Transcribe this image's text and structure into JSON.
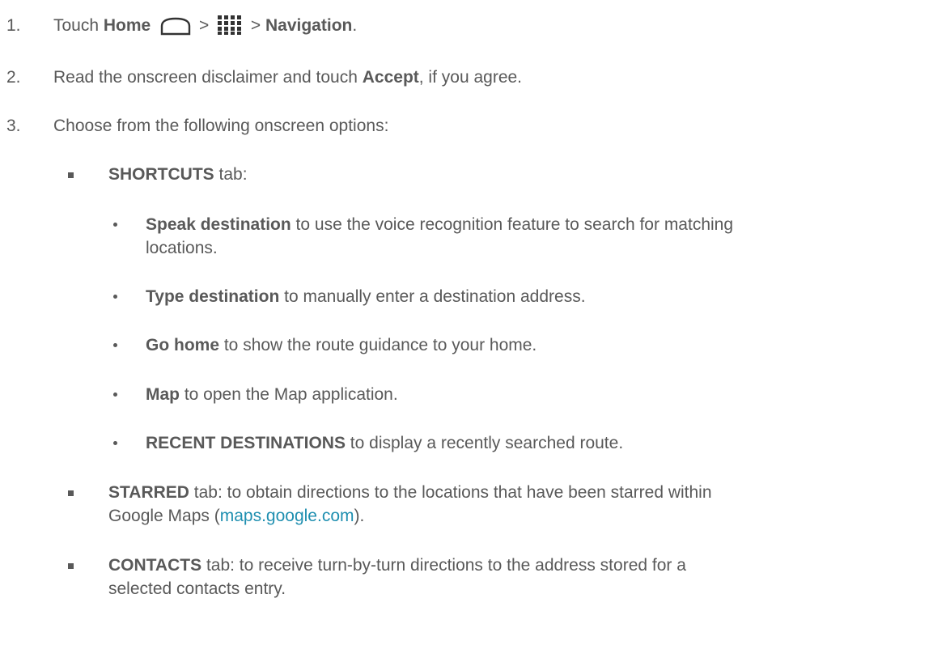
{
  "steps": [
    {
      "num": "1.",
      "pre": "Touch",
      "home_bold": "Home",
      "sep1": ">",
      "sep2": ">",
      "nav_bold": "Navigation",
      "end": "."
    },
    {
      "num": "2.",
      "pre": "Read the onscreen disclaimer and touch",
      "bold": "Accept",
      "post": ", if you agree."
    },
    {
      "num": "3.",
      "text": "Choose from the following onscreen options:"
    }
  ],
  "shortcuts": {
    "bold": "SHORTCUTS",
    "post": " tab:",
    "items": [
      {
        "bold": "Speak destination",
        "line1": " to use the voice recognition feature to search for matching",
        "line2": "locations."
      },
      {
        "bold": "Type destination",
        "post": " to manually enter a destination address."
      },
      {
        "bold": "Go home",
        "post": " to show the route guidance to your home."
      },
      {
        "bold": "Map",
        "post": " to open the Map application."
      },
      {
        "bold": "RECENT DESTINATIONS",
        "post": " to display a recently searched route."
      }
    ]
  },
  "starred": {
    "bold": "STARRED",
    "line1": " tab: to obtain directions to the locations that have been starred within",
    "line2_pre": "Google Maps (",
    "link": "maps.google.com",
    "line2_post": ")."
  },
  "contacts": {
    "bold": "CONTACTS",
    "line1": " tab: to receive turn-by-turn directions to the address stored for a",
    "line2": "selected contacts entry."
  },
  "colors": {
    "text": "#595959",
    "link": "#1f8fb0"
  },
  "icons": {
    "home": "home-outline-icon",
    "apps": "apps-grid-icon"
  }
}
